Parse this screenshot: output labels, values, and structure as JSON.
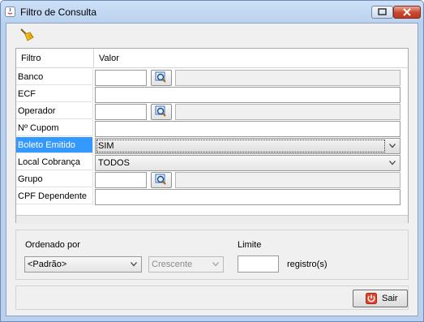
{
  "window": {
    "title": "Filtro de Consulta"
  },
  "table": {
    "header_filtro": "Filtro",
    "header_valor": "Valor",
    "rows": [
      {
        "label": "Banco"
      },
      {
        "label": "ECF"
      },
      {
        "label": "Operador"
      },
      {
        "label": "Nº Cupom"
      },
      {
        "label": "Boleto Emitido",
        "value": "SIM"
      },
      {
        "label": "Local Cobrança",
        "value": "TODOS"
      },
      {
        "label": "Grupo"
      },
      {
        "label": "CPF Dependente"
      }
    ]
  },
  "order": {
    "label": "Ordenado por",
    "selected": "<Padrão>",
    "direction": "Crescente",
    "limit_label": "Limite",
    "limit_suffix": "registro(s)"
  },
  "footer": {
    "exit_label": "Sair"
  },
  "colors": {
    "selection": "#3399ff",
    "title_gradient": "#b9d1ee"
  }
}
